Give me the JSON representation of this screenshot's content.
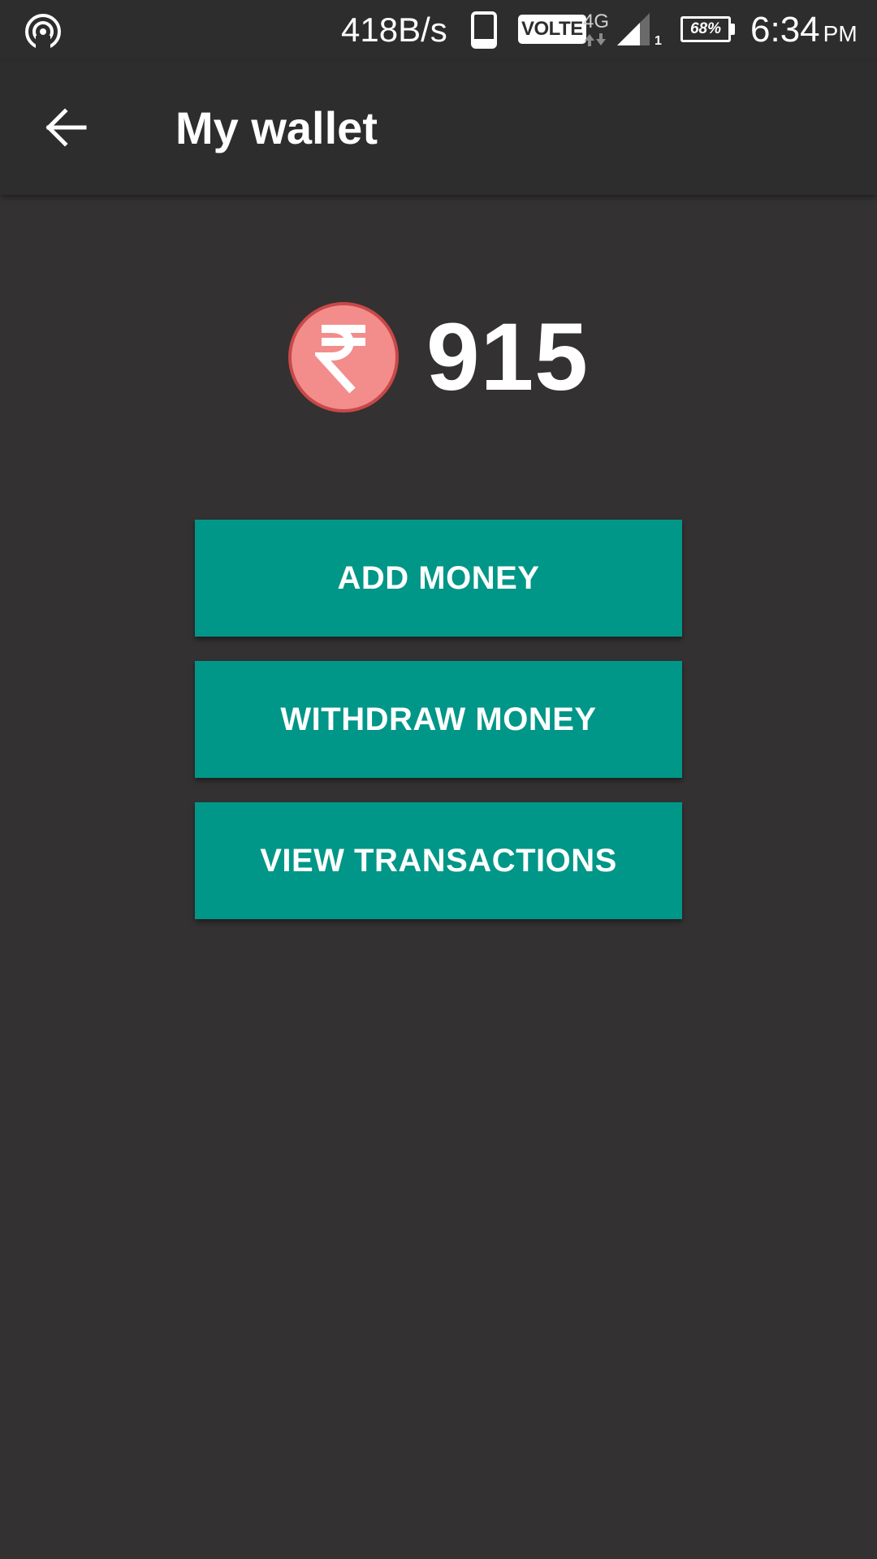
{
  "status_bar": {
    "hotspot_icon": "hotspot-icon",
    "network_speed": "418B/s",
    "volte": "VOLTE",
    "network_type": "4G",
    "sim_slot": "1",
    "battery": "68%",
    "time": "6:34",
    "ampm": "PM"
  },
  "app_bar": {
    "back_icon": "arrow-left-icon",
    "title": "My wallet"
  },
  "balance": {
    "currency_icon": "rupee-coin-icon",
    "currency_color": "#f28d8c",
    "amount": "915"
  },
  "actions": {
    "add_money": "ADD MONEY",
    "withdraw_money": "WITHDRAW MONEY",
    "view_transactions": "VIEW TRANSACTIONS"
  },
  "colors": {
    "background": "#333132",
    "bar": "#2d2d2d",
    "accent": "#009688"
  }
}
